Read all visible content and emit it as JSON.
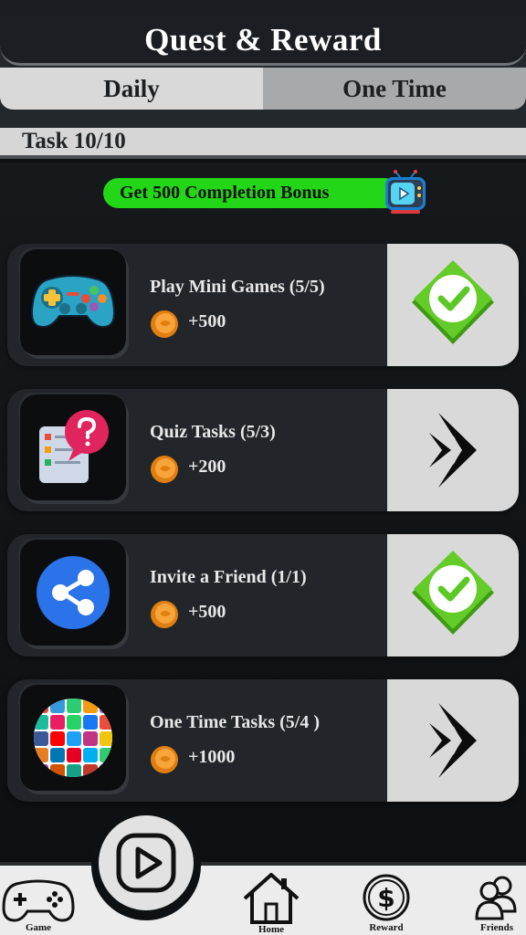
{
  "header": {
    "title": "Quest & Reward",
    "tabs": [
      {
        "label": "Daily",
        "active": true
      },
      {
        "label": "One Time",
        "active": false
      }
    ]
  },
  "task_counter": "Task 10/10",
  "bonus": {
    "label": "Get 500 Completion Bonus",
    "icon": "tv-play-icon",
    "color": "#23d617"
  },
  "tasks": [
    {
      "title": "Play Mini Games (5/5)",
      "reward": "+500",
      "icon": "gamepad-icon",
      "status": "completed"
    },
    {
      "title": "Quiz Tasks (5/3)",
      "reward": "+200",
      "icon": "quiz-icon",
      "status": "go"
    },
    {
      "title": "Invite a Friend (1/1)",
      "reward": "+500",
      "icon": "share-icon",
      "status": "completed"
    },
    {
      "title": "One Time Tasks (5/4 )",
      "reward": "+1000",
      "icon": "social-apps-icon",
      "status": "go"
    }
  ],
  "nav": {
    "items": [
      {
        "label": "Game",
        "icon": "gamepad-outline-icon"
      },
      {
        "label": "Home",
        "icon": "home-icon"
      },
      {
        "label": "Reward",
        "icon": "dollar-coin-icon"
      },
      {
        "label": "Friends",
        "icon": "friends-icon"
      }
    ],
    "center_icon": "play-button-icon"
  },
  "colors": {
    "check_green": "#5cc826",
    "coin_orange": "#f39a1d",
    "panel_bg": "#22262a"
  }
}
